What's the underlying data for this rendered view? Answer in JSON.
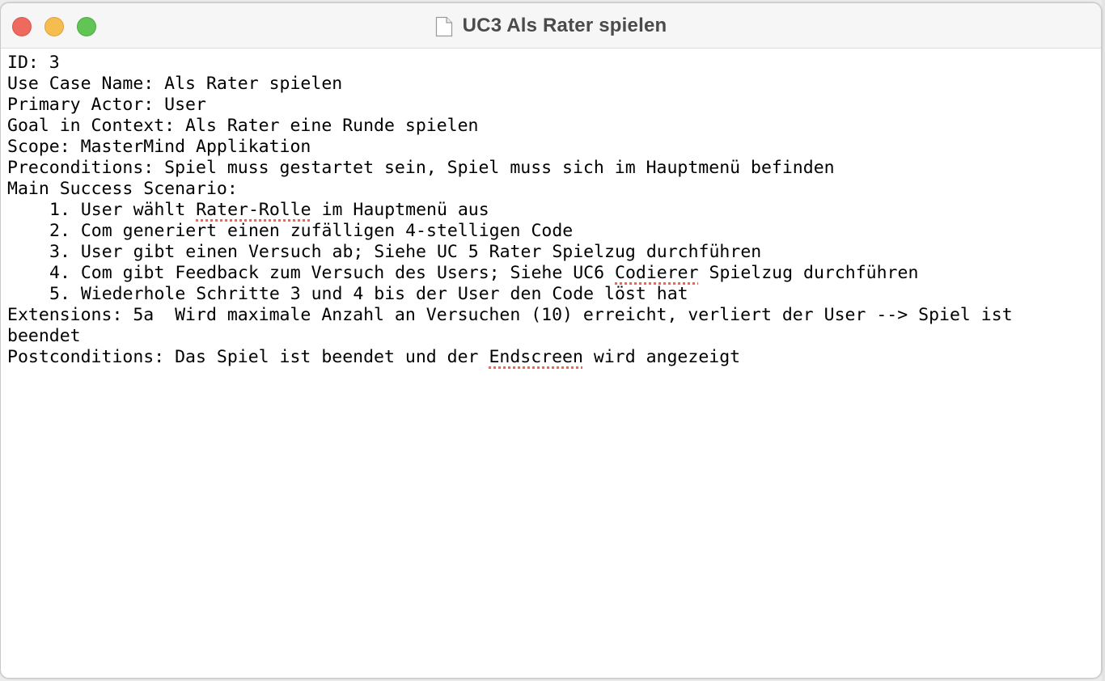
{
  "window": {
    "title": "UC3 Als Rater spielen",
    "icon": "document-icon"
  },
  "document": {
    "id_line": "ID: 3",
    "use_case_name": "Use Case Name: Als Rater spielen",
    "primary_actor": "Primary Actor: User",
    "goal": "Goal in Context: Als Rater eine Runde spielen",
    "scope": "Scope: MasterMind Applikation",
    "preconditions": "Preconditions: Spiel muss gestartet sein, Spiel muss sich im Hauptmenü befinden",
    "main_success_header": "Main Success Scenario:",
    "steps": [
      {
        "num": "1.",
        "pre": "User wählt ",
        "marked": "Rater-Rolle",
        "post": " im Hauptmenü aus"
      },
      {
        "num": "2.",
        "pre": "Com generiert einen zufälligen 4-stelligen Code",
        "marked": "",
        "post": ""
      },
      {
        "num": "3.",
        "pre": "User gibt einen Versuch ab; Siehe UC 5 Rater Spielzug durchführen",
        "marked": "",
        "post": ""
      },
      {
        "num": "4.",
        "pre": "Com gibt Feedback zum Versuch des Users; Siehe UC6 ",
        "marked": "Codierer",
        "post": " Spielzug durchführen"
      },
      {
        "num": "5.",
        "pre": "Wiederhole Schritte 3 und 4 bis der User den Code löst hat",
        "marked": "",
        "post": ""
      }
    ],
    "extensions": "Extensions: 5a  Wird maximale Anzahl an Versuchen (10) erreicht, verliert der User --> Spiel ist beendet",
    "postconditions_pre": "Postconditions: Das Spiel ist beendet und der ",
    "postconditions_marked": "Endscreen",
    "postconditions_post": " wird angezeigt"
  },
  "colors": {
    "close": "#ee6a5e",
    "minimize": "#f5bd4f",
    "zoom": "#61c454",
    "spellcheck": "#e06a5e"
  }
}
